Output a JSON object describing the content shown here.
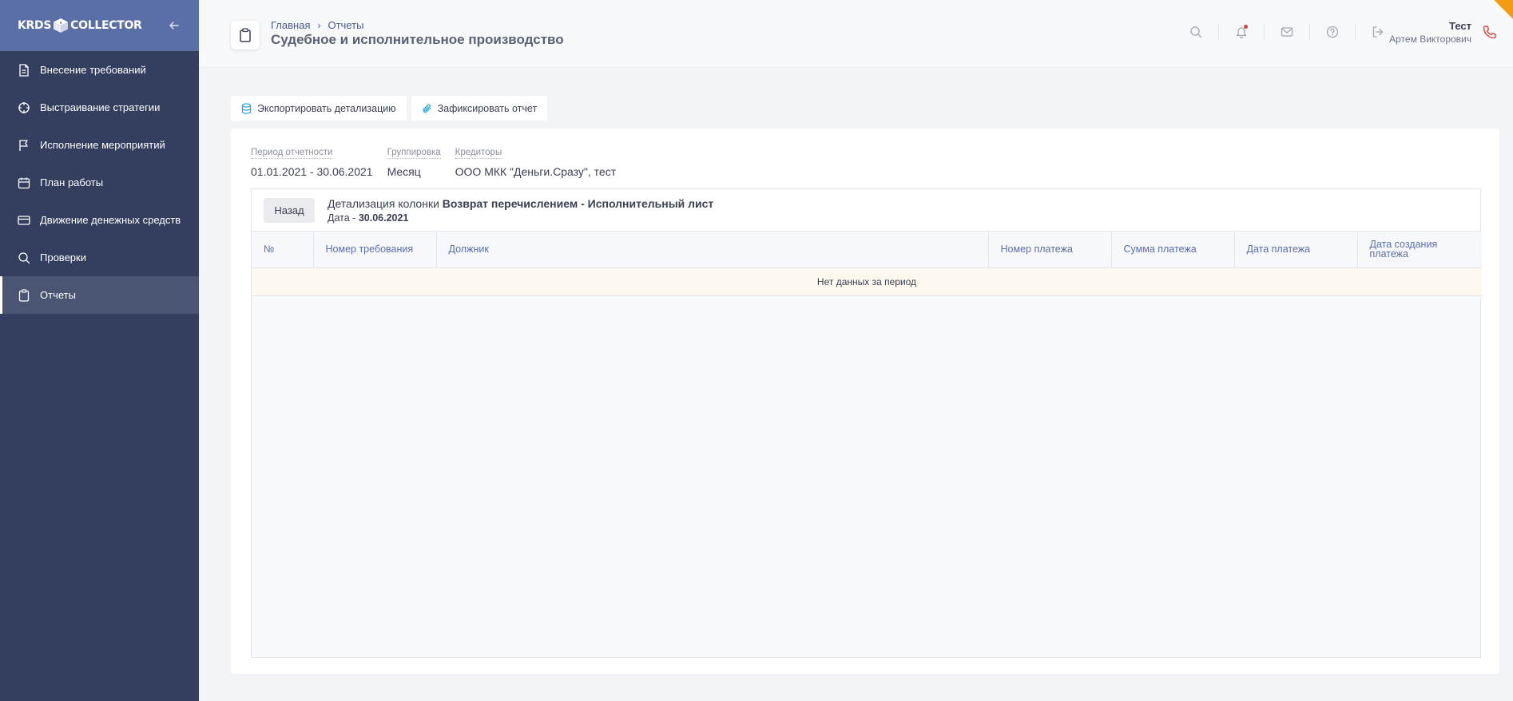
{
  "app": {
    "logo_left": "KRDS",
    "logo_right": "COLLECTOR"
  },
  "sidebar": {
    "items": [
      {
        "label": "Внесение требований",
        "icon": "document-icon"
      },
      {
        "label": "Выстраивание стратегии",
        "icon": "crosshair-icon"
      },
      {
        "label": "Исполнение мероприятий",
        "icon": "flag-icon"
      },
      {
        "label": "План работы",
        "icon": "calendar-icon"
      },
      {
        "label": "Движение денежных средств",
        "icon": "card-icon"
      },
      {
        "label": "Проверки",
        "icon": "search-icon"
      },
      {
        "label": "Отчеты",
        "icon": "clipboard-icon",
        "active": true
      }
    ]
  },
  "header": {
    "breadcrumb": [
      "Главная",
      "Отчеты"
    ],
    "breadcrumb_sep": "›",
    "title": "Судебное и исполнительное производство",
    "user": {
      "name": "Тест",
      "full_name": "Артем Викторович"
    }
  },
  "toolbar": {
    "export_label": "Экспортировать детализацию",
    "fix_label": "Зафиксировать отчет"
  },
  "filters": [
    {
      "label": "Период отчетности",
      "value": "01.01.2021 - 30.06.2021"
    },
    {
      "label": "Группировка",
      "value": "Месяц"
    },
    {
      "label": "Кредиторы",
      "value": "ООО МКК \"Деньги.Сразу\", тест"
    }
  ],
  "detail": {
    "back_label": "Назад",
    "prefix": "Детализация колонки",
    "column": "Возврат перечислением - Исполнительный лист",
    "date_prefix": "Дата -",
    "date": "30.06.2021"
  },
  "table": {
    "columns": [
      "№",
      "Номер требования",
      "Должник",
      "Номер платежа",
      "Сумма платежа",
      "Дата платежа",
      "Дата создания платежа"
    ],
    "empty_text": "Нет данных за период"
  },
  "colors": {
    "sidebar": "#343e5e",
    "sidebar_head": "#5a6fa6",
    "accent": "#5a6fa6",
    "empty_row": "#fdf9ee"
  }
}
